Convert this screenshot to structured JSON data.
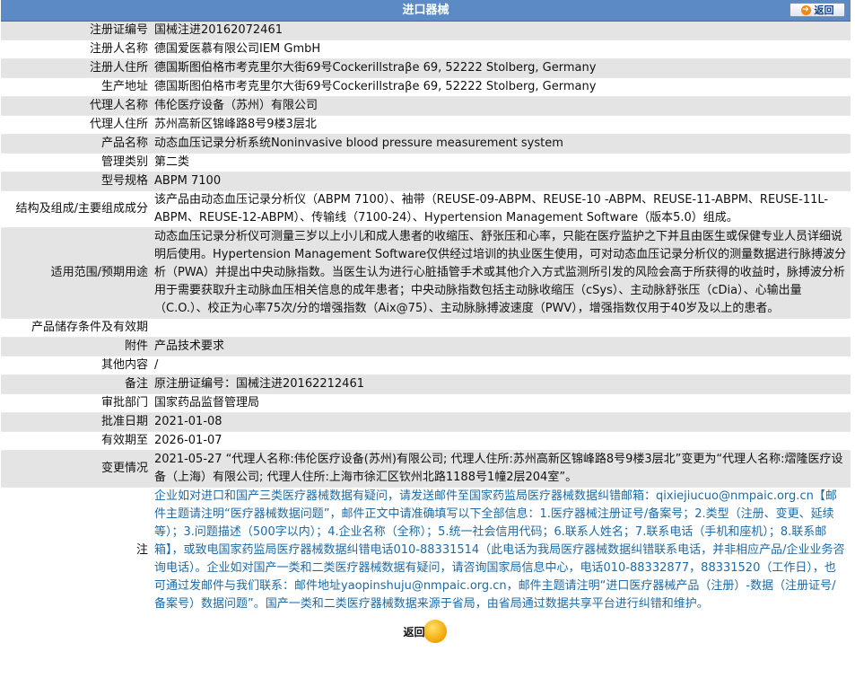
{
  "header": {
    "title": "进口器械",
    "back_label": "返回"
  },
  "rows": [
    {
      "key": "注册证编号",
      "value": "国械注进20162072461"
    },
    {
      "key": "注册人名称",
      "value": "德国爱医慕有限公司IEM GmbH"
    },
    {
      "key": "注册人住所",
      "value": "德国斯图伯格市考克里尔大街69号Cockerillstraβe 69, 52222 Stolberg, Germany"
    },
    {
      "key": "生产地址",
      "value": "德国斯图伯格市考克里尔大街69号Cockerillstraβe 69, 52222 Stolberg, Germany"
    },
    {
      "key": "代理人名称",
      "value": "伟伦医疗设备（苏州）有限公司"
    },
    {
      "key": "代理人住所",
      "value": "苏州高新区锦峰路8号9楼3层北"
    },
    {
      "key": "产品名称",
      "value": "动态血压记录分析系统Noninvasive blood pressure measurement system"
    },
    {
      "key": "管理类别",
      "value": "第二类"
    },
    {
      "key": "型号规格",
      "value": "ABPM 7100"
    },
    {
      "key": "结构及组成/主要组成成分",
      "value": "该产品由动态血压记录分析仪（ABPM 7100）、袖带（REUSE-09-ABPM、REUSE-10 -ABPM、REUSE-11-ABPM、REUSE-11L-ABPM、REUSE-12-ABPM）、传输线（7100-24）、Hypertension Management Software（版本5.0）组成。"
    },
    {
      "key": "适用范围/预期用途",
      "value": "动态血压记录分析仪可测量三岁以上小儿和成人患者的收缩压、舒张压和心率，只能在医疗监护之下并且由医生或保健专业人员详细说明后使用。Hypertension Management Software仅供经过培训的执业医生使用，可对动态血压记录分析仪的测量数据进行脉搏波分析（PWA）并提出中央动脉指数。当医生认为进行心脏插管手术或其他介入方式监测所引发的风险会高于所获得的收益时，脉搏波分析用于需要获取升主动脉血压相关信息的成年患者；中央动脉指数包括主动脉收缩压（cSys）、主动脉舒张压（cDia）、心输出量（C.O.）、校正为心率75次/分的增强指数（Aix@75）、主动脉脉搏波速度（PWV），增强指数仅用于40岁及以上的患者。"
    },
    {
      "key": "产品储存条件及有效期",
      "value": ""
    },
    {
      "key": "附件",
      "value": "产品技术要求"
    },
    {
      "key": "其他内容",
      "value": "/"
    },
    {
      "key": "备注",
      "value": "原注册证编号：国械注进20162212461"
    },
    {
      "key": "审批部门",
      "value": "国家药品监督管理局"
    },
    {
      "key": "批准日期",
      "value": "2021-01-08"
    },
    {
      "key": "有效期至",
      "value": "2026-01-07"
    },
    {
      "key": "变更情况",
      "value": "2021-05-27 “代理人名称:伟伦医疗设备(苏州)有限公司; 代理人住所:苏州高新区锦峰路8号9楼3层北”变更为“代理人名称:熠隆医疗设备（上海）有限公司; 代理人住所:上海市徐汇区钦州北路1188号1幢2层204室”。"
    }
  ],
  "note": {
    "key": "注",
    "value": "企业如对进口和国产三类医疗器械数据有疑问，请发送邮件至国家药监局医疗器械数据纠错邮箱：qixiejiucuo@nmpaic.org.cn【邮件主题请注明“医疗器械数据问题”，邮件正文中请准确填写以下全部信息：1.医疗器械注册证号/备案号；2.类型（注册、变更、延续等）；3.问题描述（500字以内）；4.企业名称（全称）；5.统一社会信用代码；6.联系人姓名；7.联系电话（手机和座机）；8.联系邮箱】，或致电国家药监局医疗器械数据纠错电话010-88331514（此电话为我局医疗器械数据纠错联系电话，并非相应产品/企业业务咨询电话）。企业如对国产一类和二类医疗器械数据有疑问，请咨询国家局信息中心，电话010-88332877，88331520（工作日），也可通过发邮件与我们联系：邮件地址yaopinshuju@nmpaic.org.cn，邮件主题请注明“进口医疗器械产品（注册）-数据（注册证号/备案号）数据问题”。国产一类和二类医疗器械数据来源于省局，由省局通过数据共享平台进行纠错和维护。"
  },
  "footer": {
    "back_label": "返回"
  }
}
